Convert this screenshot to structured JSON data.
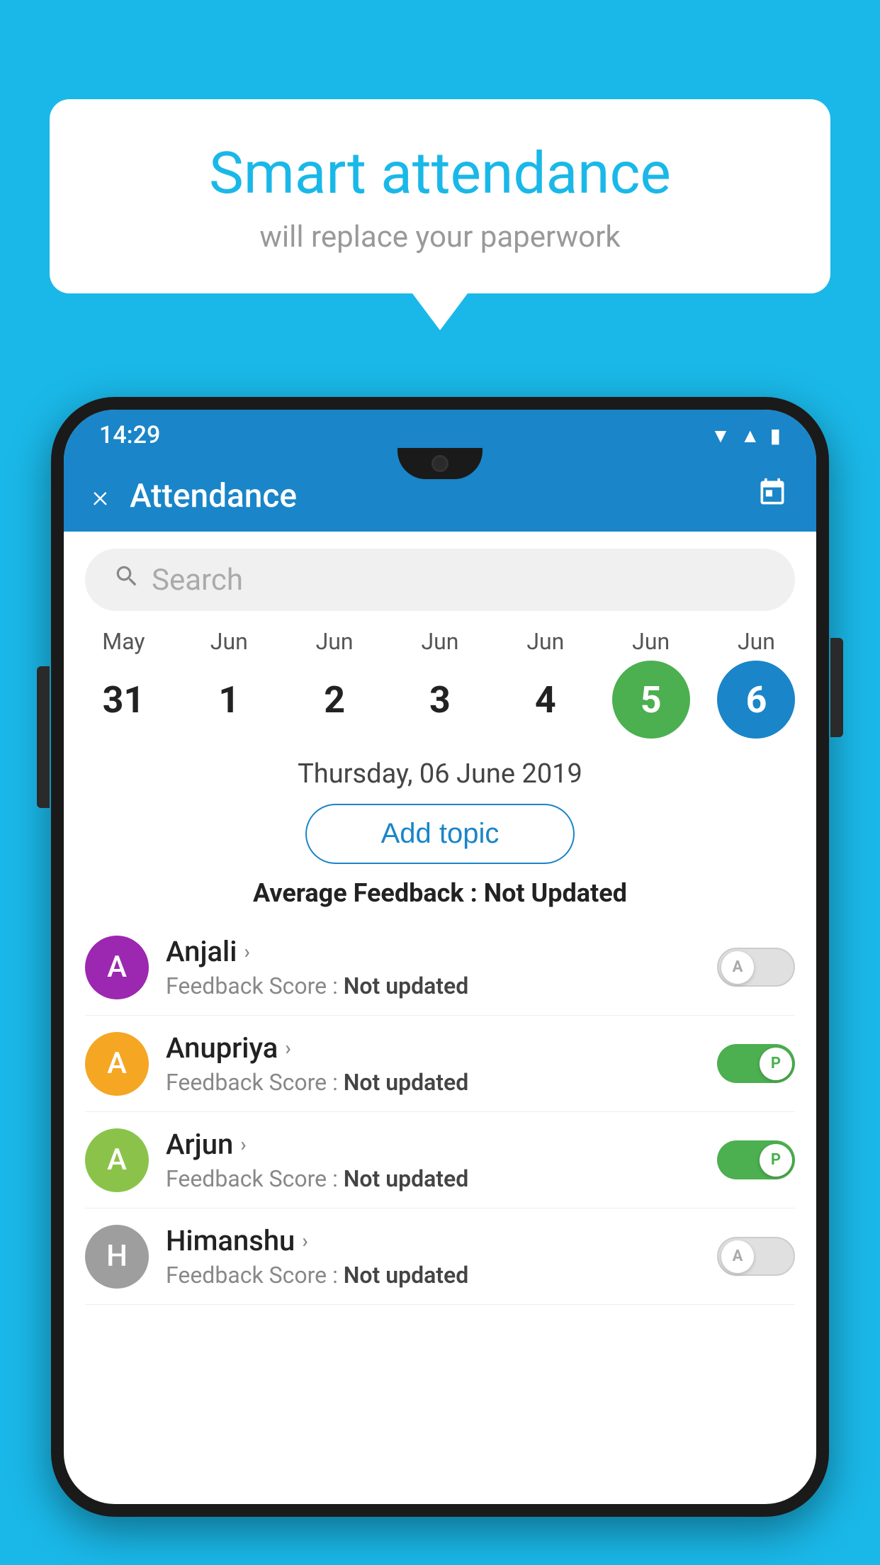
{
  "background_color": "#1ab8e8",
  "speech_bubble": {
    "title": "Smart attendance",
    "subtitle": "will replace your paperwork"
  },
  "status_bar": {
    "time": "14:29",
    "icons": [
      "wifi",
      "signal",
      "battery"
    ]
  },
  "app_header": {
    "title": "Attendance",
    "close_label": "×",
    "calendar_icon": "📅"
  },
  "search": {
    "placeholder": "Search"
  },
  "date_strip": {
    "columns": [
      {
        "month": "May",
        "day": "31",
        "state": "normal"
      },
      {
        "month": "Jun",
        "day": "1",
        "state": "normal"
      },
      {
        "month": "Jun",
        "day": "2",
        "state": "normal"
      },
      {
        "month": "Jun",
        "day": "3",
        "state": "normal"
      },
      {
        "month": "Jun",
        "day": "4",
        "state": "normal"
      },
      {
        "month": "Jun",
        "day": "5",
        "state": "today"
      },
      {
        "month": "Jun",
        "day": "6",
        "state": "selected"
      }
    ]
  },
  "selected_date_label": "Thursday, 06 June 2019",
  "add_topic_label": "Add topic",
  "average_feedback": {
    "label": "Average Feedback : ",
    "value": "Not Updated"
  },
  "students": [
    {
      "name": "Anjali",
      "avatar_letter": "A",
      "avatar_color": "#9c27b0",
      "feedback_label": "Feedback Score : ",
      "feedback_value": "Not updated",
      "toggle_state": "off",
      "toggle_label": "A"
    },
    {
      "name": "Anupriya",
      "avatar_letter": "A",
      "avatar_color": "#f5a623",
      "feedback_label": "Feedback Score : ",
      "feedback_value": "Not updated",
      "toggle_state": "on",
      "toggle_label": "P"
    },
    {
      "name": "Arjun",
      "avatar_letter": "A",
      "avatar_color": "#8bc34a",
      "feedback_label": "Feedback Score : ",
      "feedback_value": "Not updated",
      "toggle_state": "on",
      "toggle_label": "P"
    },
    {
      "name": "Himanshu",
      "avatar_letter": "H",
      "avatar_color": "#9e9e9e",
      "feedback_label": "Feedback Score : ",
      "feedback_value": "Not updated",
      "toggle_state": "off",
      "toggle_label": "A"
    }
  ]
}
